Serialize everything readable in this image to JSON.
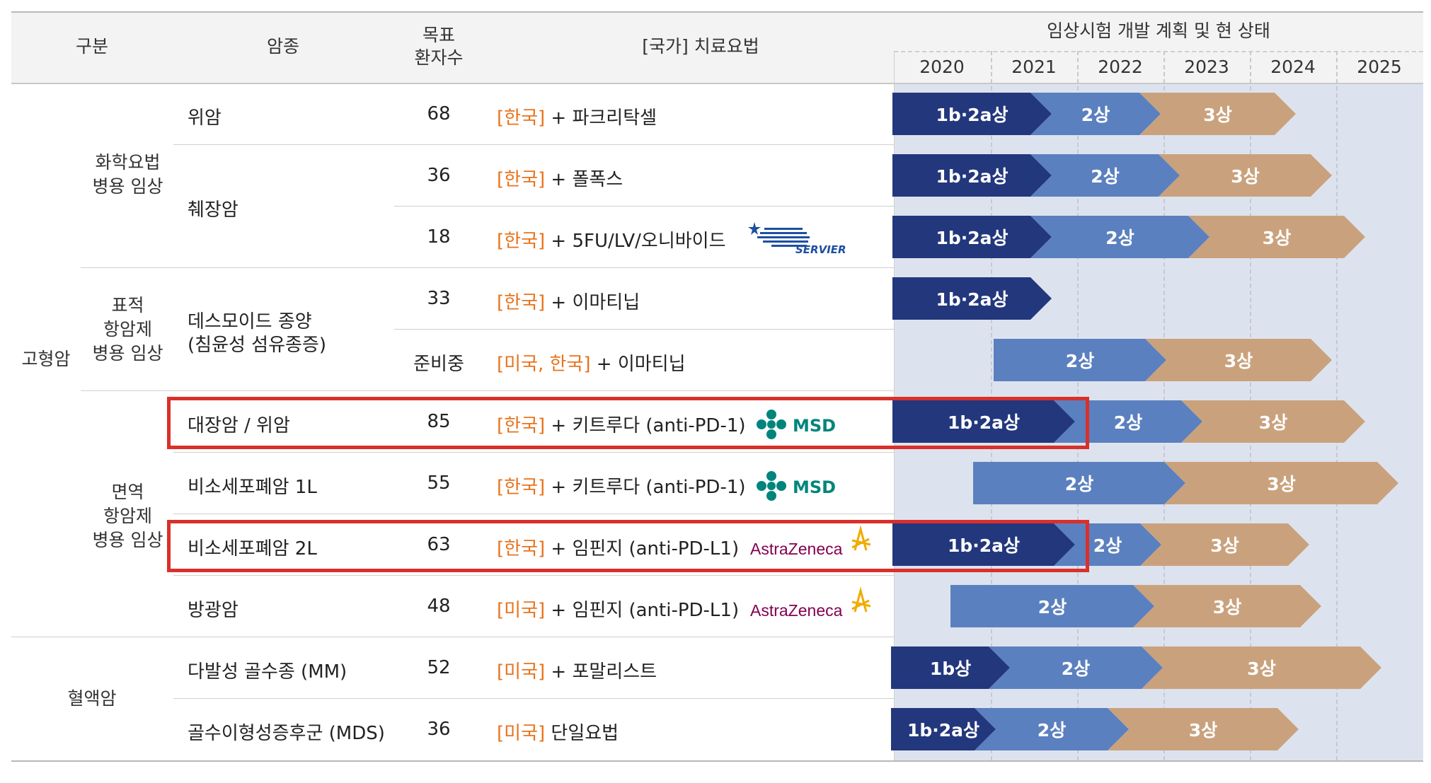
{
  "header": {
    "category": "구분",
    "cancer_type": "암종",
    "target_line1": "목표",
    "target_line2": "환자수",
    "therapy": "[국가] 치료요법",
    "timeline_title": "임상시험 개발 계획 및 현 상태",
    "years": [
      "2020",
      "2021",
      "2022",
      "2023",
      "2024",
      "2025"
    ]
  },
  "groups": {
    "solid": "고형암",
    "chemo_line1": "화학요법",
    "chemo_line2": "병용 임상",
    "targeted_line1": "표적",
    "targeted_line2": "항암제",
    "targeted_line3": "병용 임상",
    "immuno_line1": "면역",
    "immuno_line2": "항암제",
    "immuno_line3": "병용 임상",
    "heme": "혈액암"
  },
  "cancers": {
    "gastric": "위암",
    "pancreatic": "췌장암",
    "desmoid_line1": "데스모이드 종양",
    "desmoid_line2": "(침윤성 섬유종증)",
    "crc_gastric": "대장암 / 위암",
    "nsclc_1l": "비소세포폐암 1L",
    "nsclc_2l": "비소세포폐암 2L",
    "bladder": "방광암",
    "mm": "다발성 골수종 (MM)",
    "mds": "골수이형성증후군 (MDS)"
  },
  "rows": [
    {
      "target": "68",
      "country": "[한국]",
      "therapy": " + 파크리탁셀",
      "phases": [
        "1b·2a상",
        "2상",
        "3상"
      ],
      "partner": ""
    },
    {
      "target": "36",
      "country": "[한국]",
      "therapy": " + 폴폭스",
      "phases": [
        "1b·2a상",
        "2상",
        "3상"
      ],
      "partner": ""
    },
    {
      "target": "18",
      "country": "[한국]",
      "therapy": " + 5FU/LV/오니바이드",
      "phases": [
        "1b·2a상",
        "2상",
        "3상"
      ],
      "partner": "SERVIER"
    },
    {
      "target": "33",
      "country": "[한국]",
      "therapy": " + 이마티닙",
      "phases": [
        "1b·2a상"
      ],
      "partner": ""
    },
    {
      "target": "준비중",
      "country": "[미국, 한국]",
      "therapy": " + 이마티닙",
      "phases": [
        "2상",
        "3상"
      ],
      "partner": ""
    },
    {
      "target": "85",
      "country": "[한국]",
      "therapy": " + 키트루다 (anti-PD-1)",
      "phases": [
        "1b·2a상",
        "2상",
        "3상"
      ],
      "partner": "MSD"
    },
    {
      "target": "55",
      "country": "[한국]",
      "therapy": " + 키트루다 (anti-PD-1)",
      "phases": [
        "2상",
        "3상"
      ],
      "partner": "MSD"
    },
    {
      "target": "63",
      "country": "[한국]",
      "therapy": " + 임핀지 (anti-PD-L1)",
      "phases": [
        "1b·2a상",
        "2상",
        "3상"
      ],
      "partner": "AstraZeneca"
    },
    {
      "target": "48",
      "country": "[미국]",
      "therapy": " + 임핀지 (anti-PD-L1)",
      "phases": [
        "2상",
        "3상"
      ],
      "partner": "AstraZeneca"
    },
    {
      "target": "52",
      "country": "[미국]",
      "therapy": " + 포말리스트",
      "phases": [
        "1b상",
        "2상",
        "3상"
      ],
      "partner": ""
    },
    {
      "target": "36",
      "country": "[미국]",
      "therapy": " 단일요법",
      "phases": [
        "1b·2a상",
        "2상",
        "3상"
      ],
      "partner": ""
    }
  ],
  "colors": {
    "phase_1": "#23377d",
    "phase_2": "#5b80bf",
    "phase_3": "#c9a27d",
    "country": "#e8731c",
    "highlight": "#d9302a"
  }
}
